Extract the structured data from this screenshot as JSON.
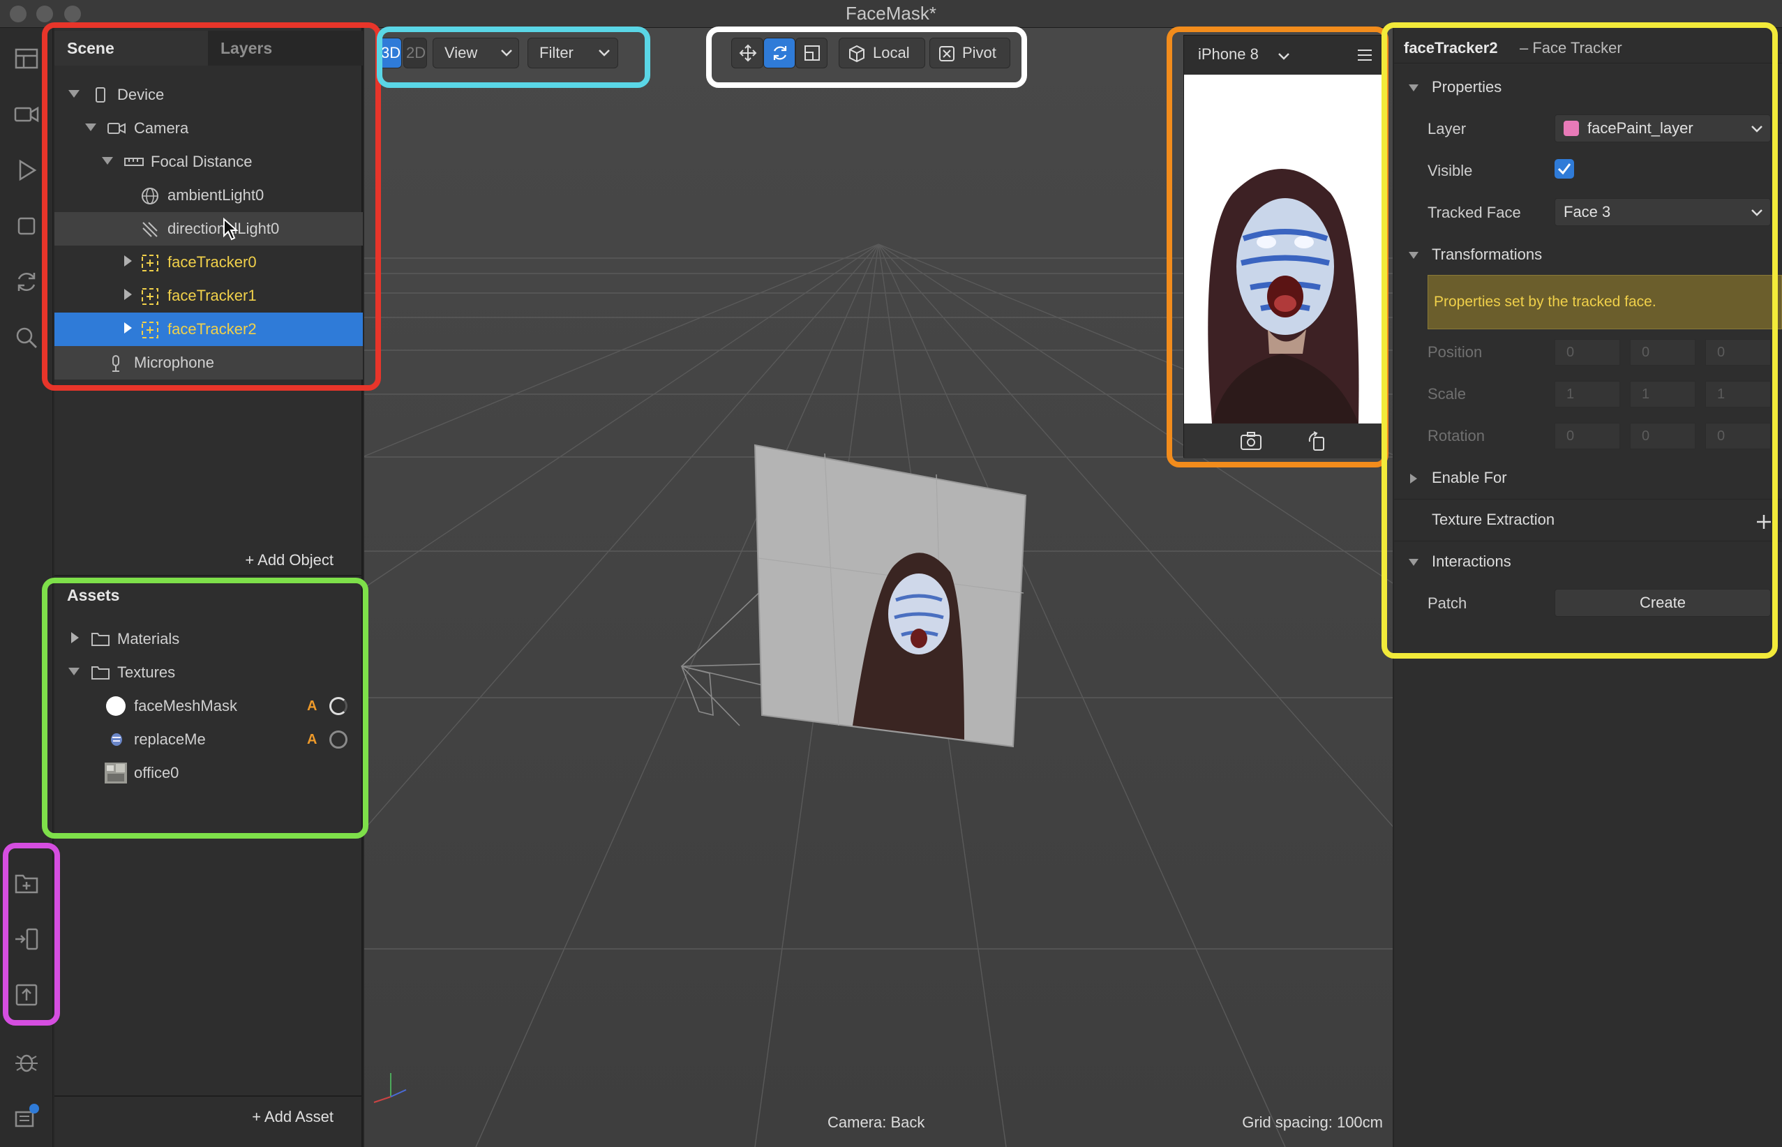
{
  "window": {
    "title": "FaceMask*"
  },
  "scene_panel": {
    "tabs": [
      "Scene",
      "Layers"
    ],
    "tree": [
      {
        "label": "Device",
        "icon": "phone-icon"
      },
      {
        "label": "Camera",
        "icon": "camera-icon"
      },
      {
        "label": "Focal Distance",
        "icon": "ruler-icon"
      },
      {
        "label": "ambientLight0",
        "icon": "globe-light-icon"
      },
      {
        "label": "directionalLight0",
        "icon": "directional-light-icon"
      },
      {
        "label": "faceTracker0",
        "icon": "face-tracker-icon"
      },
      {
        "label": "faceTracker1",
        "icon": "face-tracker-icon"
      },
      {
        "label": "faceTracker2",
        "icon": "face-tracker-icon"
      },
      {
        "label": "Microphone",
        "icon": "microphone-icon"
      }
    ],
    "add_object": "+ Add Object"
  },
  "assets_panel": {
    "title": "Assets",
    "items": [
      {
        "label": "Materials"
      },
      {
        "label": "Textures"
      },
      {
        "label": "faceMeshMask",
        "badge": "A"
      },
      {
        "label": "replaceMe",
        "badge": "A"
      },
      {
        "label": "office0"
      }
    ],
    "add_asset": "+ Add Asset"
  },
  "viewport_toolbar": {
    "mode_3d": "3D",
    "mode_2d": "2D",
    "view": "View",
    "filter": "Filter",
    "local": "Local",
    "pivot": "Pivot"
  },
  "viewport": {
    "camera_label": "Camera: Back",
    "grid_label": "Grid spacing: 100cm"
  },
  "preview": {
    "device": "iPhone 8"
  },
  "inspector": {
    "object_name": "faceTracker2",
    "object_type": "– Face Tracker",
    "sections": {
      "properties": "Properties",
      "transformations": "Transformations",
      "enable_for": "Enable For",
      "texture_extraction": "Texture Extraction",
      "interactions": "Interactions"
    },
    "layer_label": "Layer",
    "layer_value": "facePaint_layer",
    "visible_label": "Visible",
    "visible_checked": true,
    "tracked_face_label": "Tracked Face",
    "tracked_face_value": "Face 3",
    "notice": "Properties set by the tracked face.",
    "position_label": "Position",
    "position": [
      "0",
      "0",
      "0"
    ],
    "scale_label": "Scale",
    "scale": [
      "1",
      "1",
      "1"
    ],
    "rotation_label": "Rotation",
    "rotation": [
      "0",
      "0",
      "0"
    ],
    "patch_label": "Patch",
    "create_button": "Create"
  },
  "colors": {
    "accent": "#2f7bd8",
    "tracker": "#f0d04a",
    "layer_swatch": "#e87ab8",
    "asset_badge": "#ee9a2a",
    "annotations": {
      "scene": "#e8352a",
      "viewport_mode": "#5ad6e6",
      "manipulators": "#ffffff",
      "preview": "#f28c1c",
      "inspector": "#f2ea3a",
      "assets": "#7ee04a",
      "bottom_tools": "#d54ee0"
    }
  }
}
